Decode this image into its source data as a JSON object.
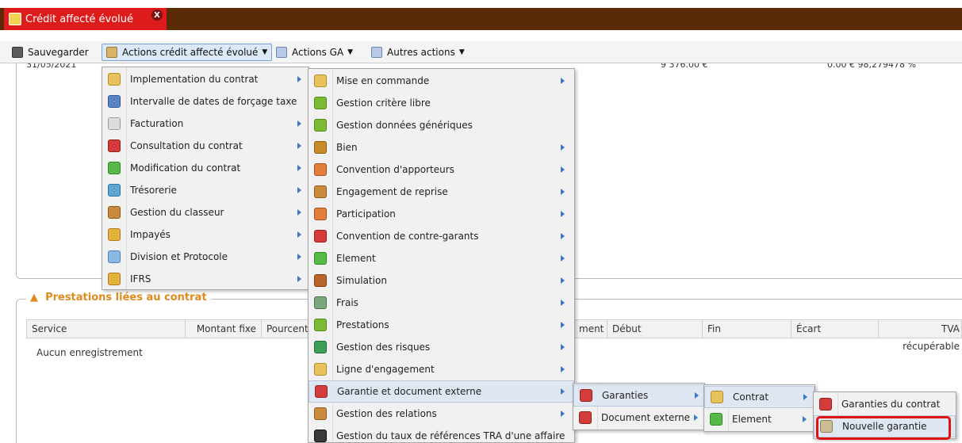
{
  "window": {
    "tab_title": "Crédit affecté évolué",
    "tab_close_glyph": "X"
  },
  "toolbar": {
    "save_label": "Sauvegarder",
    "actions_credit_label": "Actions crédit affecté évolué",
    "actions_ga_label": "Actions GA",
    "autres_actions_label": "Autres actions"
  },
  "background": {
    "partial_row": {
      "date": "31/05/2021",
      "amount": "9 376.00 €",
      "right_value": "0.00 €  98,279478 %"
    },
    "section_title": "Prestations liées au contrat",
    "columns": [
      "Service",
      "Montant fixe",
      "Pourcent",
      "ment",
      "Début",
      "Fin",
      "Écart",
      "TVA récupérable"
    ],
    "empty_message": "Aucun enregistrement"
  },
  "menu1": {
    "items": [
      {
        "label": "Implementation du contrat",
        "icon": "config-icon",
        "submenu": true
      },
      {
        "label": "Intervalle de dates de forçage taxe",
        "icon": "calendar-icon",
        "submenu": false
      },
      {
        "label": "Facturation",
        "icon": "magnifier-icon",
        "submenu": true
      },
      {
        "label": "Consultation du contrat",
        "icon": "document-icon",
        "submenu": true
      },
      {
        "label": "Modification du contrat",
        "icon": "plus-icon",
        "submenu": true
      },
      {
        "label": "Trésorerie",
        "icon": "cycle-icon",
        "submenu": true
      },
      {
        "label": "Gestion du classeur",
        "icon": "binder-icon",
        "submenu": true
      },
      {
        "label": "Impayés",
        "icon": "coins-icon",
        "submenu": true
      },
      {
        "label": "Division et Protocole",
        "icon": "split-icon",
        "submenu": true
      },
      {
        "label": "IFRS",
        "icon": "coins-icon",
        "submenu": true
      }
    ]
  },
  "menu2": {
    "items": [
      {
        "label": "Mise en commande",
        "icon": "config-icon",
        "submenu": true
      },
      {
        "label": "Gestion critère libre",
        "icon": "green-circle-icon",
        "submenu": false
      },
      {
        "label": "Gestion données génériques",
        "icon": "green-circle-icon",
        "submenu": false
      },
      {
        "label": "Bien",
        "icon": "house-icon",
        "submenu": true
      },
      {
        "label": "Convention d'apporteurs",
        "icon": "hand-icon",
        "submenu": true
      },
      {
        "label": "Engagement de reprise",
        "icon": "binder-icon",
        "submenu": true
      },
      {
        "label": "Participation",
        "icon": "hand-icon",
        "submenu": true
      },
      {
        "label": "Convention de contre-garants",
        "icon": "document-icon",
        "submenu": true
      },
      {
        "label": "Element",
        "icon": "plus-icon",
        "submenu": true
      },
      {
        "label": "Simulation",
        "icon": "calculator-icon",
        "submenu": true
      },
      {
        "label": "Frais",
        "icon": "fees-icon",
        "submenu": true
      },
      {
        "label": "Prestations",
        "icon": "green-circle-icon",
        "submenu": true
      },
      {
        "label": "Gestion des risques",
        "icon": "risk-icon",
        "submenu": true
      },
      {
        "label": "Ligne d'engagement",
        "icon": "config-icon",
        "submenu": true
      },
      {
        "label": "Garantie et document externe",
        "icon": "document-icon",
        "submenu": true
      },
      {
        "label": "Gestion des relations",
        "icon": "binder-icon",
        "submenu": true
      },
      {
        "label": "Gestion du taux de références TRA d'une affaire",
        "icon": "rate-icon",
        "submenu": false
      }
    ]
  },
  "menu3": {
    "items": [
      {
        "label": "Garanties",
        "icon": "document-icon",
        "submenu": true
      },
      {
        "label": "Document externe",
        "icon": "document-icon",
        "submenu": true
      }
    ]
  },
  "menu4": {
    "items": [
      {
        "label": "Contrat",
        "icon": "config-icon",
        "submenu": true
      },
      {
        "label": "Element",
        "icon": "plus-icon",
        "submenu": true
      }
    ]
  },
  "menu5": {
    "items": [
      {
        "label": "Garanties du contrat",
        "icon": "document-icon",
        "submenu": false
      },
      {
        "label": "Nouvelle garantie",
        "icon": "notepad-icon",
        "submenu": false
      }
    ]
  }
}
